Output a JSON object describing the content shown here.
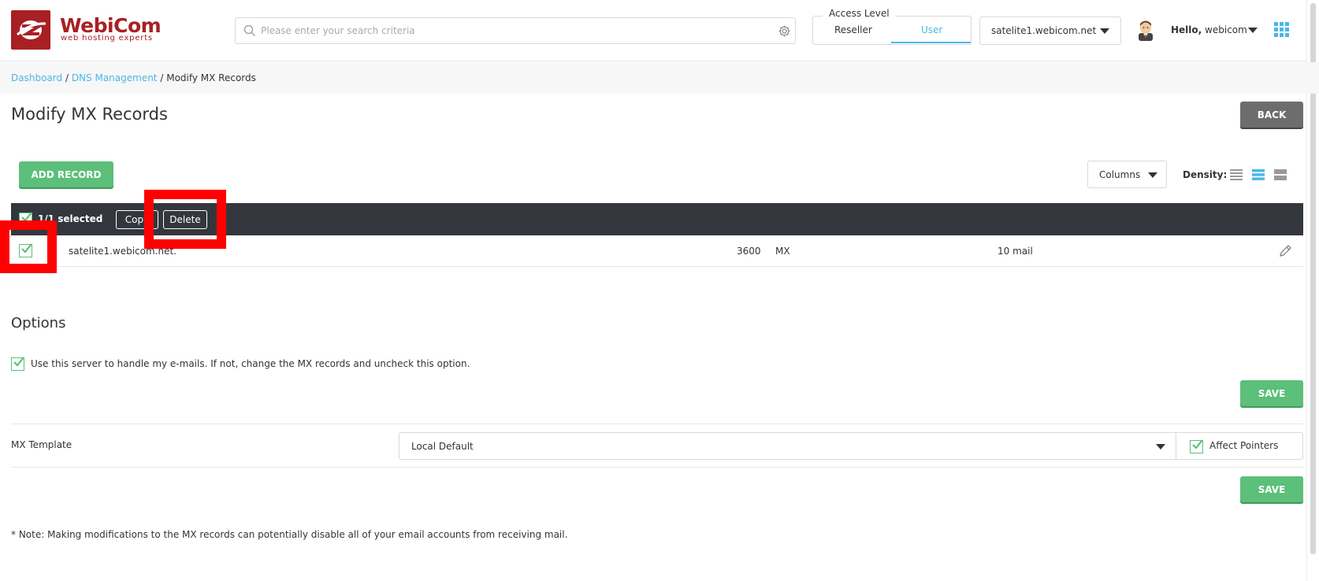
{
  "brand": {
    "name": "WebiCom",
    "tagline": "web hosting experts"
  },
  "header": {
    "search_placeholder": "Please enter your search criteria",
    "access_level": {
      "legend": "Access Level",
      "options": [
        "Reseller",
        "User"
      ],
      "selected": "User"
    },
    "server": "satelite1.webicom.net",
    "greeting_bold": "Hello,",
    "username": "webicom"
  },
  "breadcrumb": {
    "items": [
      "Dashboard",
      "DNS Management"
    ],
    "current": "Modify MX Records",
    "sep": "/"
  },
  "page": {
    "title": "Modify MX Records",
    "back_label": "BACK"
  },
  "records": {
    "add_label": "ADD RECORD",
    "columns_label": "Columns",
    "density_label": "Density:",
    "density_selected": "comfortable",
    "selection_text": "1/1 selected",
    "copy_label": "Copy",
    "delete_label": "Delete",
    "rows": [
      {
        "name": "satelite1.webicom.net.",
        "ttl": "3600",
        "type": "MX",
        "value": "10 mail",
        "checked": true
      }
    ]
  },
  "options": {
    "title": "Options",
    "handle_email_label": "Use this server to handle my e-mails. If not, change the MX records and uncheck this option.",
    "save_label": "SAVE"
  },
  "mx_template": {
    "label": "MX Template",
    "selected": "Local Default",
    "affect_pointers_label": "Affect Pointers",
    "save_label": "SAVE"
  },
  "note": "* Note: Making modifications to the MX records can potentially disable all of your email accounts from receiving mail.",
  "colors": {
    "brand_red": "#a82024",
    "accent_blue": "#4bb7e8",
    "save_green": "#5cbf7a",
    "dark_toolbar": "#33373d",
    "highlight_red": "#ff0000"
  }
}
